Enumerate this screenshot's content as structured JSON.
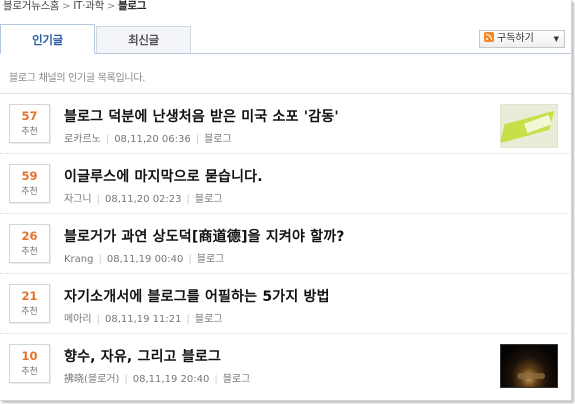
{
  "breadcrumb": {
    "items": [
      "블로거뉴스홈",
      "IT·과학",
      "블로그"
    ],
    "separator": ">"
  },
  "tabs": [
    {
      "label": "인기글",
      "active": true
    },
    {
      "label": "최신글",
      "active": false
    }
  ],
  "subscribe": {
    "label": "구독하기",
    "icon": "rss-icon",
    "caret_icon": "chevron-down-icon"
  },
  "description": "블로그 채널의 인기글 목록입니다.",
  "vote_label": "추천",
  "posts": [
    {
      "votes": "57",
      "vote_label": "추천",
      "title": "블로그 덕분에 난생처음 받은 미국 소포 '감동'",
      "author": "로카르노",
      "date": "08,11,20 06:36",
      "category": "블로그",
      "thumbnail": "green-package-thumbnail"
    },
    {
      "votes": "59",
      "vote_label": "추천",
      "title": "이글루스에 마지막으로 묻습니다.",
      "author": "자그니",
      "date": "08,11,20 02:23",
      "category": "블로그",
      "thumbnail": null
    },
    {
      "votes": "26",
      "vote_label": "추천",
      "title": "블로거가 과연 상도덕[商道德]을 지켜야 할까?",
      "author": "Krang",
      "date": "08,11,19 00:40",
      "category": "블로그",
      "thumbnail": null
    },
    {
      "votes": "21",
      "vote_label": "추천",
      "title": "자기소개서에 블로그를 어필하는 5가지 방법",
      "author": "메아리",
      "date": "08,11,19 11:21",
      "category": "블로그",
      "thumbnail": null
    },
    {
      "votes": "10",
      "vote_label": "추천",
      "title": "향수, 자유, 그리고 블로그",
      "author": "拂晓(블로거)",
      "date": "08,11,19 20:40",
      "category": "블로그",
      "thumbnail": "dark-photo-thumbnail"
    }
  ],
  "colors": {
    "vote_number": "#e5732a",
    "tab_active_text": "#2a5ca8",
    "tab_border": "#b7c7dd"
  }
}
